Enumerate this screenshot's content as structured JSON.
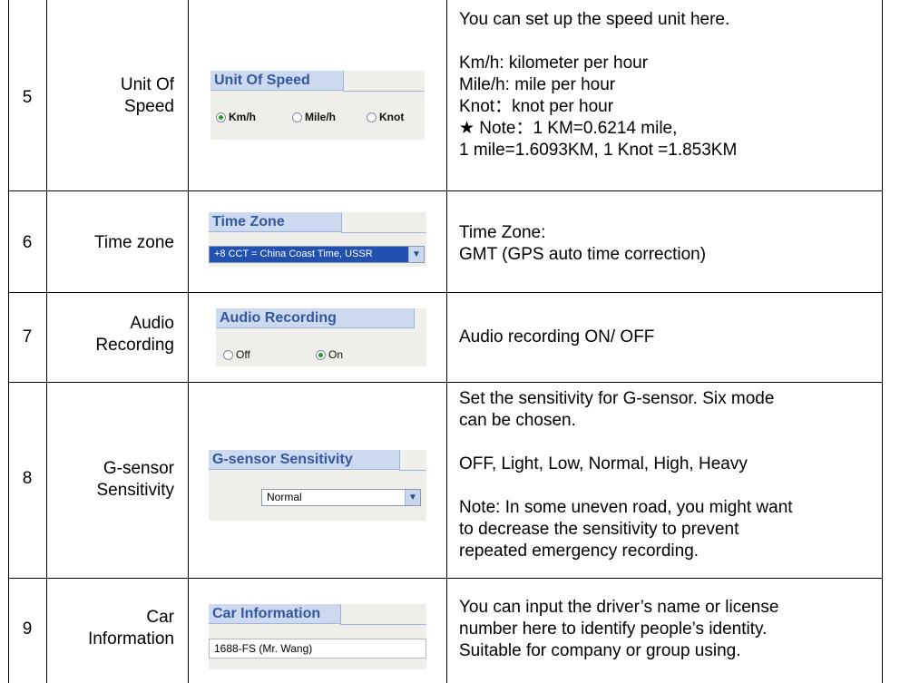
{
  "rows": [
    {
      "num": "5",
      "name": "Unit Of\nSpeed",
      "widget": {
        "title": "Unit Of Speed",
        "options": [
          "Km/h",
          "Mile/h",
          "Knot"
        ],
        "selected": "Km/h"
      },
      "desc": "You can set up the speed unit here.\n\nKm/h: kilometer per hour\nMile/h: mile per hour\nKnot：knot per hour\n★ Note：1 KM=0.6214 mile,\n1 mile=1.6093KM, 1 Knot =1.853KM"
    },
    {
      "num": "6",
      "name": "Time zone",
      "widget": {
        "title": "Time Zone",
        "value": "+8  CCT = China Coast Time, USSR"
      },
      "desc": "Time Zone:\nGMT (GPS auto time correction)"
    },
    {
      "num": "7",
      "name": "Audio\nRecording",
      "widget": {
        "title": "Audio Recording",
        "options": [
          "Off",
          "On"
        ],
        "selected": "On"
      },
      "desc": "Audio recording ON/ OFF"
    },
    {
      "num": "8",
      "name": "G-sensor\nSensitivity",
      "widget": {
        "title": "G-sensor Sensitivity",
        "value": "Normal"
      },
      "desc": "Set the sensitivity for G-sensor.    Six mode\ncan be chosen.\n\nOFF, Light, Low, Normal, High, Heavy\n\nNote: In some uneven road, you might want\nto decrease the sensitivity to prevent\nrepeated emergency recording."
    },
    {
      "num": "9",
      "name": "Car\nInformation",
      "widget": {
        "title": "Car Information",
        "value": "1688-FS (Mr. Wang)"
      },
      "desc": "You can input the driver’s name or license\nnumber here to identify people’s identity.\nSuitable for company or group using."
    }
  ],
  "colors": {
    "panel": "#efeeea",
    "title_bar": "#ccd9ee",
    "title_text": "#35579e",
    "border": "#000000"
  }
}
